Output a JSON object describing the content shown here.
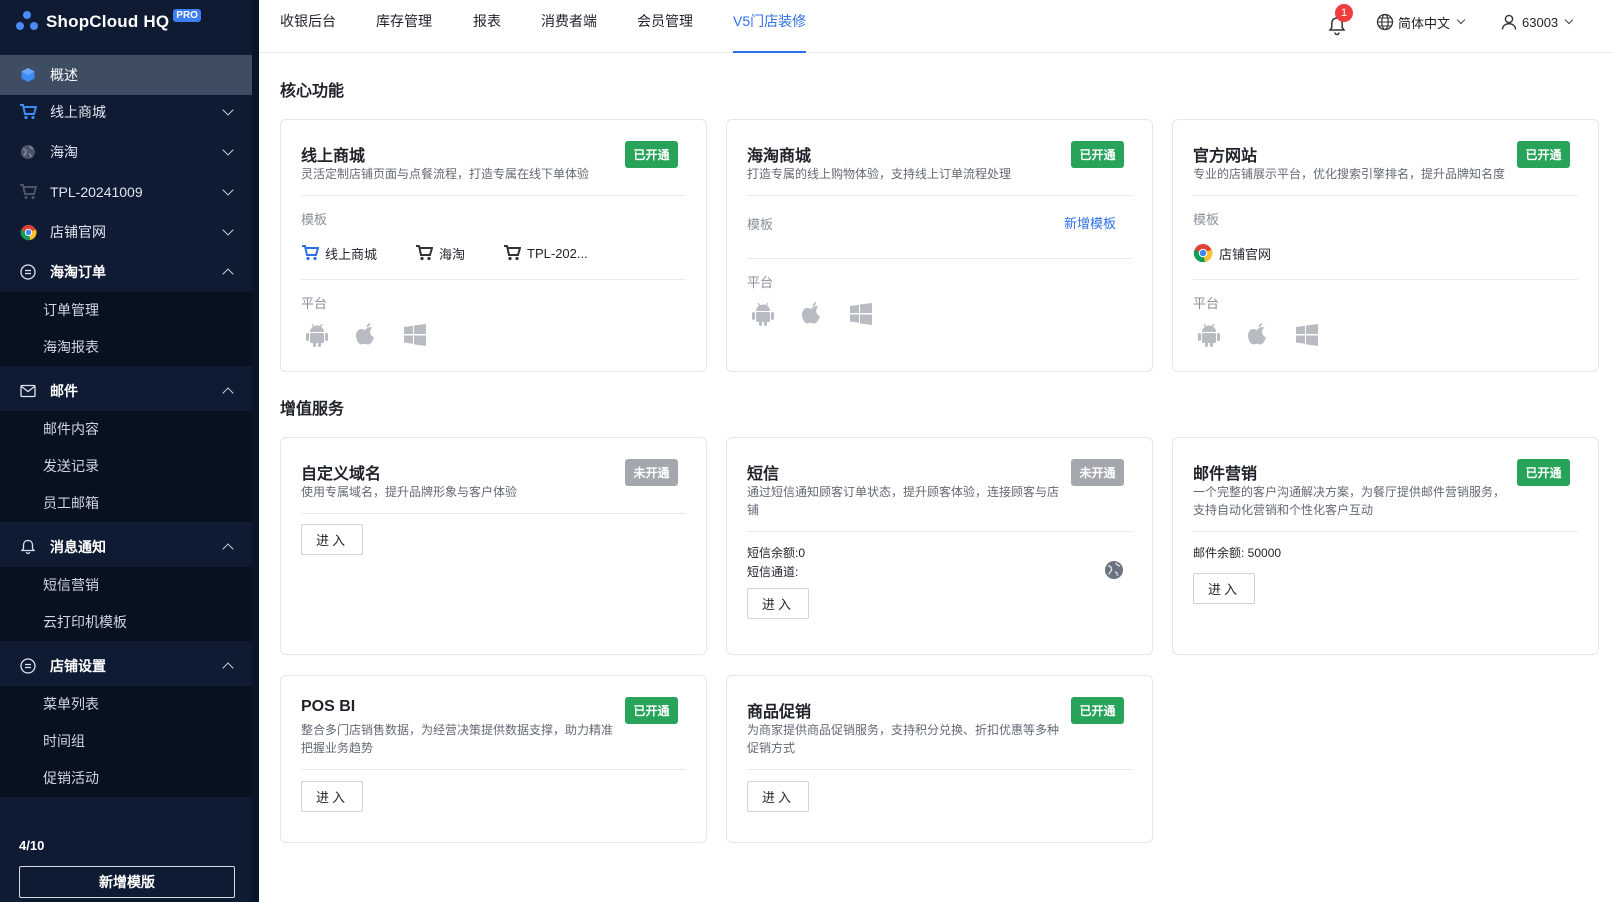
{
  "brand": {
    "name": "ShopCloud HQ",
    "badge": "PRO"
  },
  "sidebar": {
    "overview": "概述",
    "stores": [
      {
        "label": "线上商城",
        "icon": "cart-icon"
      },
      {
        "label": "海淘",
        "icon": "globe-icon"
      },
      {
        "label": "TPL-20241009",
        "icon": "cart-icon"
      },
      {
        "label": "店铺官网",
        "icon": "chrome-icon"
      }
    ],
    "groups": {
      "haitao_orders": {
        "label": "海淘订单",
        "items": [
          "订单管理",
          "海淘报表"
        ]
      },
      "mail": {
        "label": "邮件",
        "items": [
          "邮件内容",
          "发送记录",
          "员工邮箱"
        ]
      },
      "notify": {
        "label": "消息通知",
        "items": [
          "短信营销",
          "云打印机模板"
        ]
      },
      "store_settings": {
        "label": "店铺设置",
        "items": [
          "菜单列表",
          "时间组",
          "促销活动"
        ]
      }
    },
    "count": "4/10",
    "add_button": "新增模版"
  },
  "topbar": {
    "tabs": [
      "收银后台",
      "库存管理",
      "报表",
      "消费者端",
      "会员管理",
      "V5门店装修"
    ],
    "active_tab": "V5门店装修",
    "notification_count": "1",
    "language": "简体中文",
    "user": "63003"
  },
  "core": {
    "title": "核心功能",
    "cards": [
      {
        "title": "线上商城",
        "desc": "灵活定制店铺页面与点餐流程，打造专属在线下单体验",
        "status": "已开通",
        "template_label": "模板",
        "templates": [
          "线上商城",
          "海淘",
          "TPL-202..."
        ],
        "platform_label": "平台"
      },
      {
        "title": "海淘商城",
        "desc": "打造专属的线上购物体验，支持线上订单流程处理",
        "status": "已开通",
        "template_label": "模板",
        "add_template": "新增模板",
        "platform_label": "平台"
      },
      {
        "title": "官方网站",
        "desc": "专业的店铺展示平台，优化搜索引擎排名，提升品牌知名度",
        "status": "已开通",
        "template_label": "模板",
        "templates": [
          "店铺官网"
        ],
        "platform_label": "平台"
      }
    ]
  },
  "value_added": {
    "title": "增值服务",
    "cards": [
      {
        "title": "自定义域名",
        "desc": "使用专属域名，提升品牌形象与客户体验",
        "status": "未开通",
        "enter": "进入"
      },
      {
        "title": "短信",
        "desc_line1": "通过短信通知顾客订单状态，提升顾客体验，连接顾客与店",
        "desc_line2": "铺",
        "status": "未开通",
        "balance": "短信余额:0",
        "channel": "短信通道:",
        "enter": "进入"
      },
      {
        "title": "邮件营销",
        "desc_line1": "一个完整的客户沟通解决方案，为餐厅提供邮件营销服务，",
        "desc_line2": "支持自动化营销和个性化客户互动",
        "status": "已开通",
        "balance": "邮件余额: 50000",
        "enter": "进入"
      },
      {
        "title": "POS BI",
        "desc_line1": "整合多门店销售数据，为经营决策提供数据支撑，助力精准",
        "desc_line2": "把握业务趋势",
        "status": "已开通",
        "enter": "进入"
      },
      {
        "title": "商品促销",
        "desc_line1": "为商家提供商品促销服务，支持积分兑换、折扣优惠等多种",
        "desc_line2": "促销方式",
        "status": "已开通",
        "enter": "进入"
      }
    ]
  },
  "colors": {
    "sidebar_bg": "#0e1b33",
    "active_tab": "#2f6fe4",
    "status_on": "#27a35a",
    "status_off": "#a4a8ae",
    "badge_red": "#f03d3d"
  }
}
